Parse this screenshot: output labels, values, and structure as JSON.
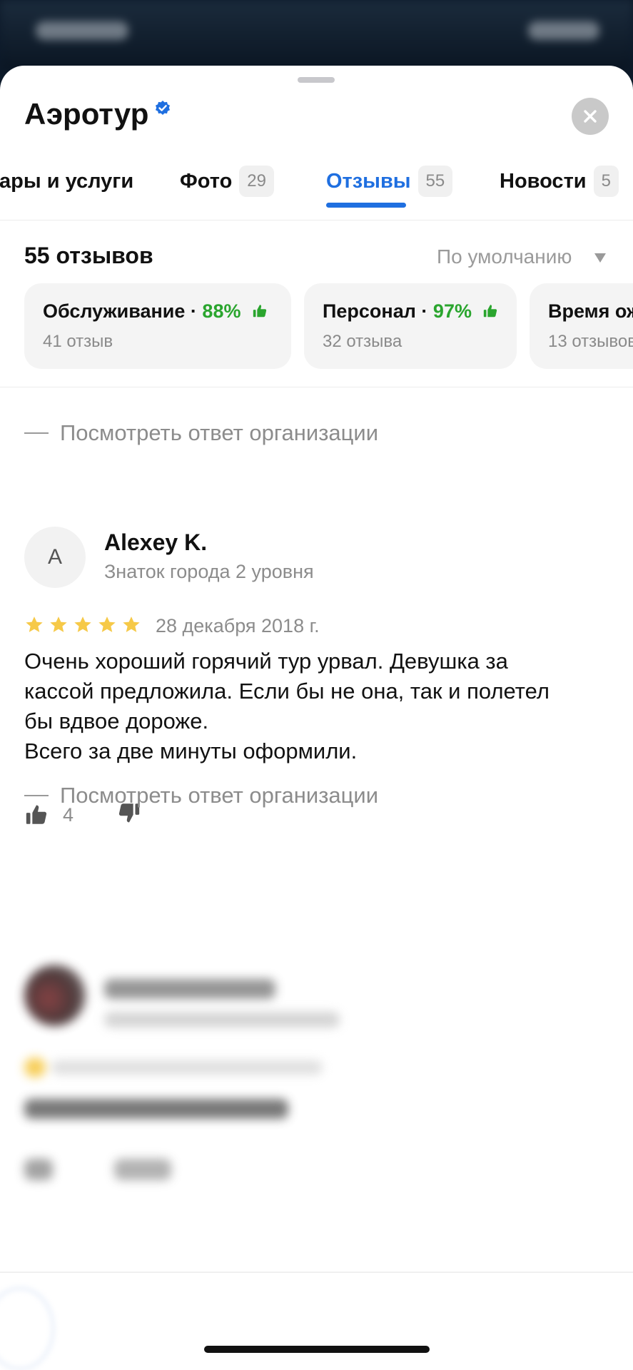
{
  "header": {
    "title": "Аэротур"
  },
  "tabs": [
    {
      "label": "Товары и услуги",
      "count": ""
    },
    {
      "label": "Фото",
      "count": "29"
    },
    {
      "label": "Отзывы",
      "count": "55"
    },
    {
      "label": "Новости",
      "count": "5"
    }
  ],
  "reviews": {
    "count_label": "55 отзывов",
    "sort_label": "По умолчанию",
    "aspects": [
      {
        "name": "Обслуживание",
        "percent": "88%",
        "sub": "41 отзыв"
      },
      {
        "name": "Персонал",
        "percent": "97%",
        "sub": "32 отзыва"
      },
      {
        "name": "Время ож",
        "percent": "",
        "sub": "13 отзывов"
      }
    ],
    "org_reply_label": "Посмотреть ответ организации",
    "items": [
      {
        "avatar_letter": "A",
        "author": "Alexey K.",
        "level": "Знаток города 2 уровня",
        "rating": 5,
        "date": "28 декабря 2018 г.",
        "text_lines": [
          "Очень хороший горячий тур урвал. Девушка за",
          "кассой предложила. Если бы не она, так и полетел",
          "бы вдвое дороже.",
          "Всего за две минуты оформили."
        ],
        "likes": "4"
      }
    ]
  },
  "colors": {
    "accent": "#1f6fe0",
    "positive": "#2aa52e",
    "star": "#f6c948"
  },
  "icons": {
    "verified": "verified-badge-icon",
    "close": "close-icon",
    "sort": "triangle-down-icon",
    "thumb_up": "thumb-up-icon",
    "thumb_down": "thumb-down-icon",
    "star": "star-icon"
  }
}
